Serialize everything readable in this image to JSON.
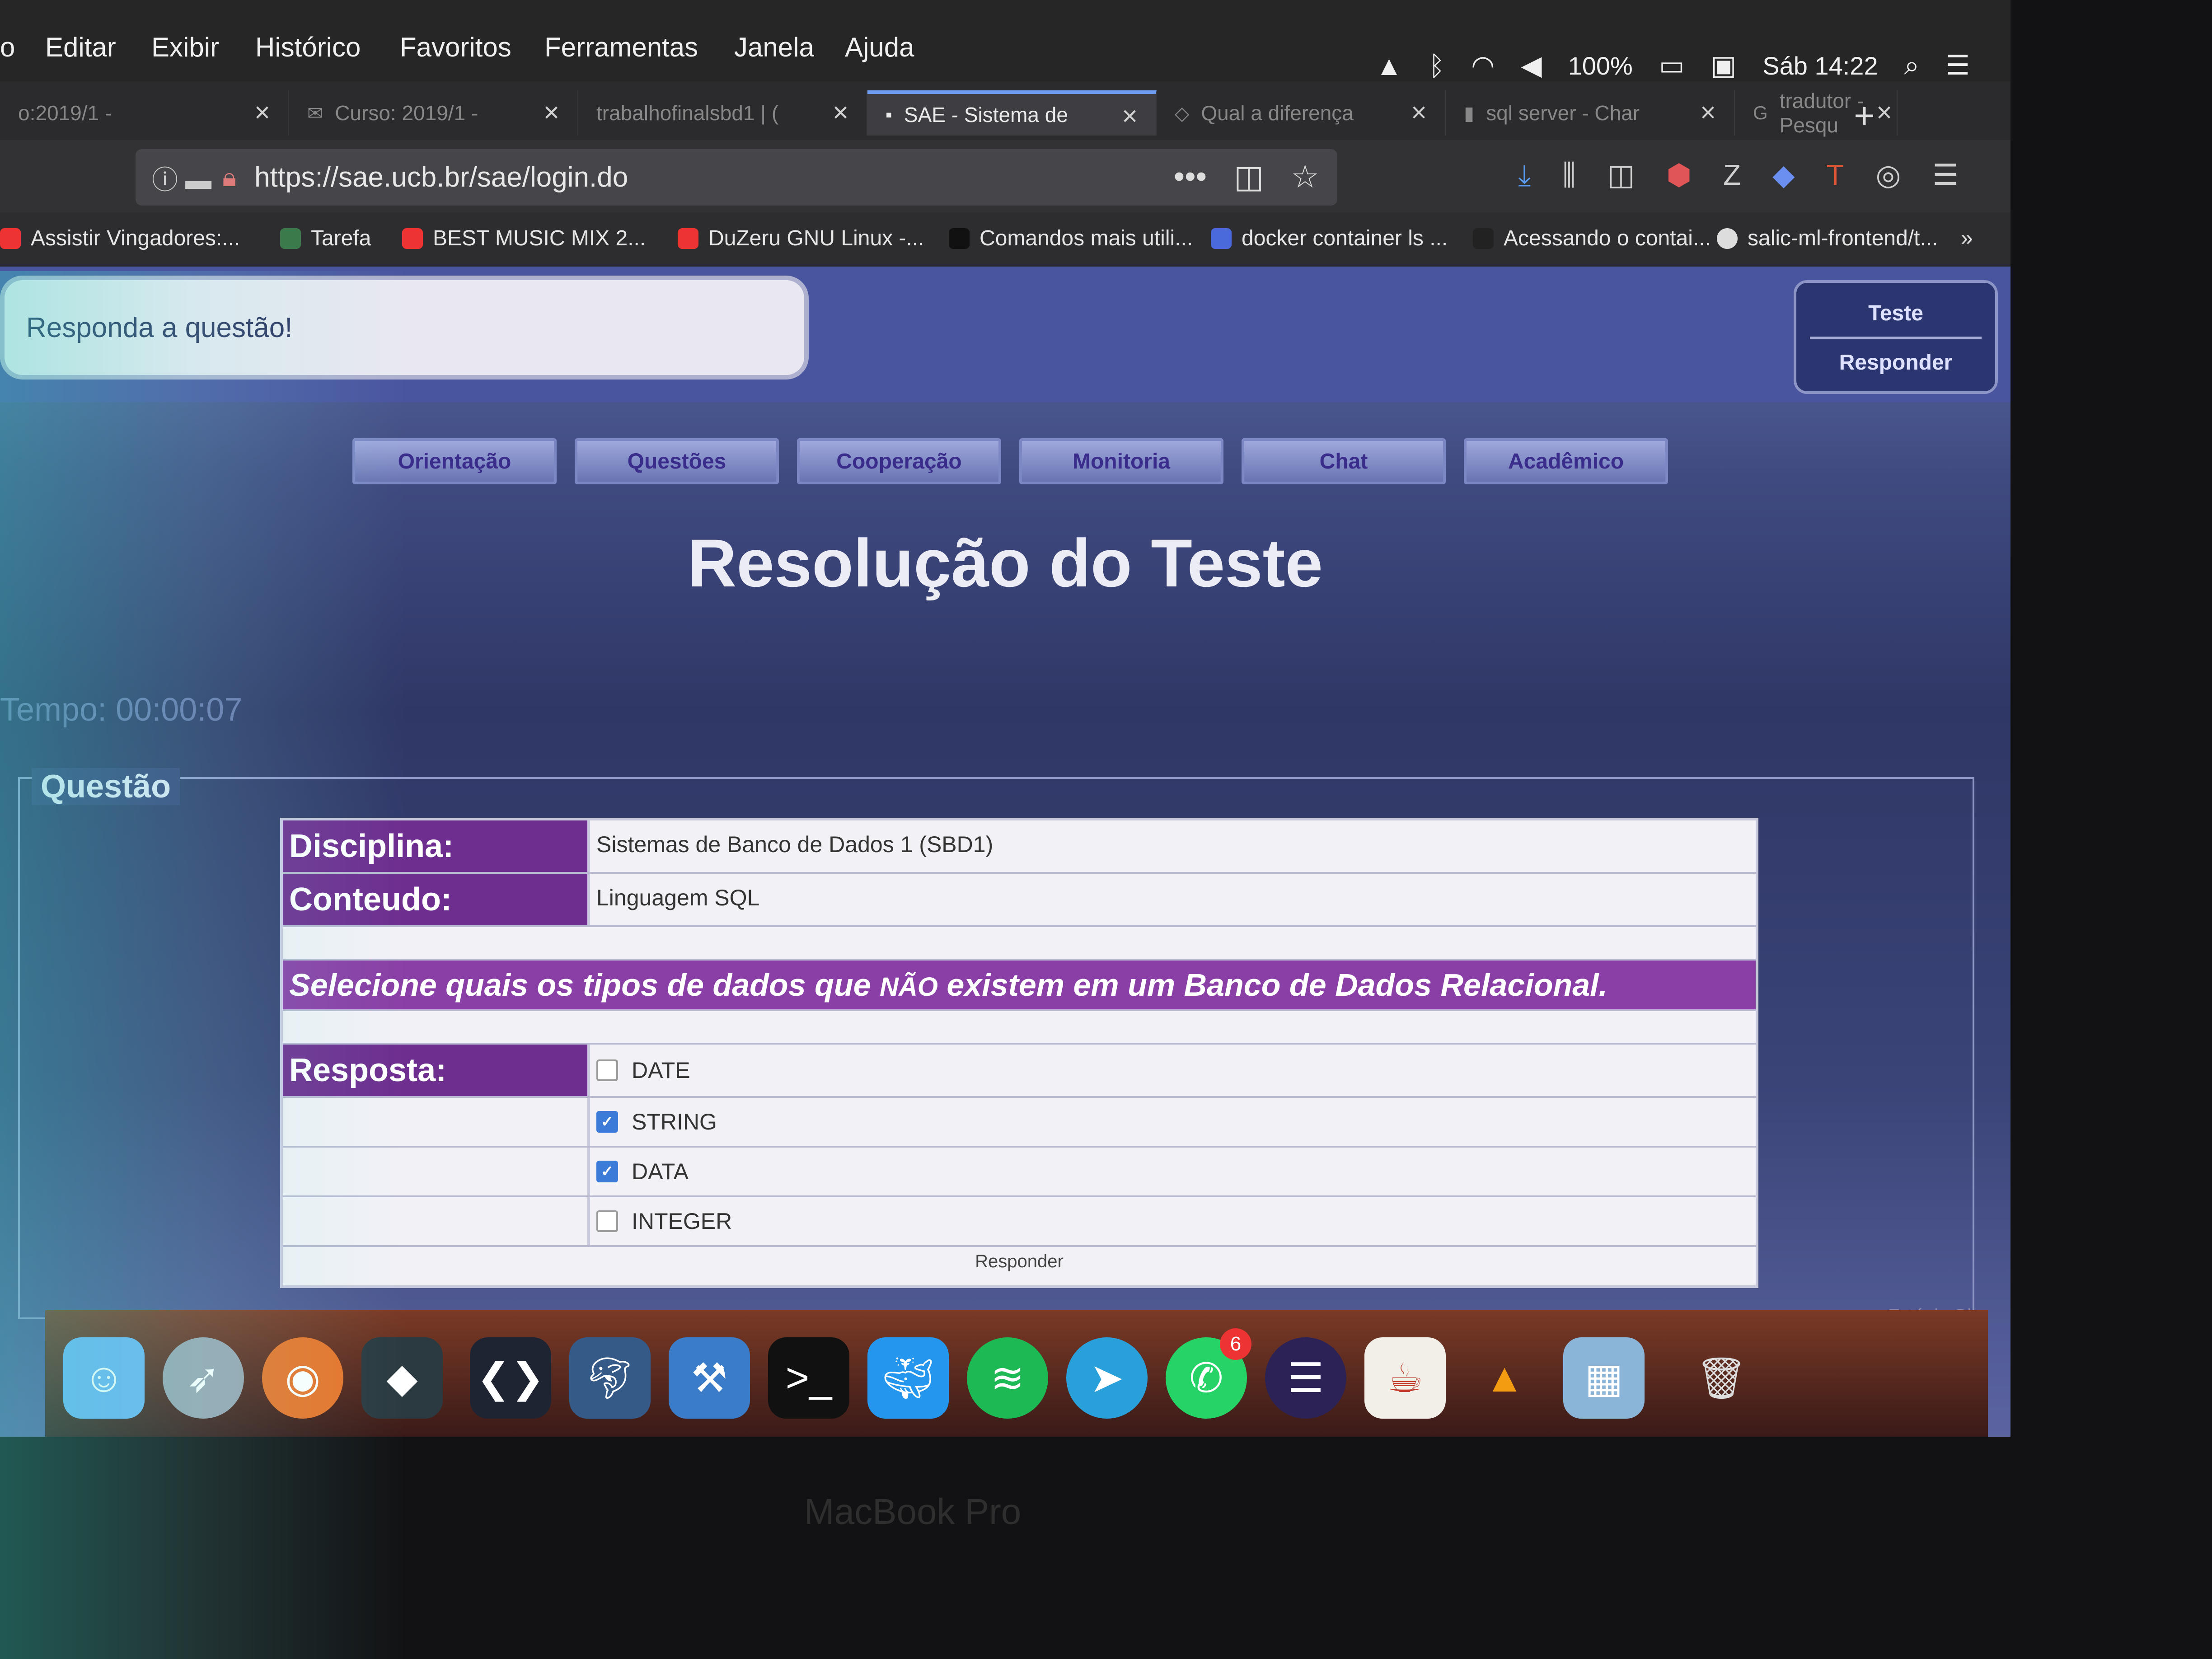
{
  "menubar": {
    "apple_fragment": "o",
    "items": [
      "Editar",
      "Exibir",
      "Histórico",
      "Favoritos",
      "Ferramentas",
      "Janela",
      "Ajuda"
    ],
    "battery": "100%",
    "clock": "Sáb 14:22"
  },
  "tabs": [
    {
      "title": "o:2019/1 -"
    },
    {
      "title": "Curso: 2019/1 -"
    },
    {
      "title": "trabalhofinalsbd1 | ("
    },
    {
      "title": "SAE - Sistema de"
    },
    {
      "title": "Qual a diferença"
    },
    {
      "title": "sql server - Char"
    },
    {
      "title": "tradutor - Pesqu"
    }
  ],
  "urlbar": {
    "url": "https://sae.ucb.br/sae/login.do"
  },
  "bookmarks": [
    "Assistir Vingadores:...",
    "Tarefa",
    "BEST MUSIC MIX 2...",
    "DuZeru GNU Linux -...",
    "Comandos mais utili...",
    "docker container ls ...",
    "Acessando o contai...",
    "salic-ml-frontend/t..."
  ],
  "header": {
    "prompt": "Responda a questão!",
    "teste_title": "Teste",
    "teste_action": "Responder"
  },
  "nav": [
    "Orientação",
    "Questões",
    "Cooperação",
    "Monitoria",
    "Chat",
    "Acadêmico"
  ],
  "page": {
    "title": "Resolução do Teste",
    "tempo": "Tempo: 00:00:07",
    "legend": "Questão",
    "footer_text": "Estágio Obr"
  },
  "question": {
    "disciplina_label": "Disciplina:",
    "disciplina_value": "Sistemas de Banco de Dados 1 (SBD1)",
    "conteudo_label": "Conteudo:",
    "conteudo_value": "Linguagem SQL",
    "text_before": "Selecione quais os tipos de dados que",
    "text_emphasis": "NÃO",
    "text_after": "existem em um Banco de Dados Relacional.",
    "resposta_label": "Resposta:",
    "options": [
      {
        "label": "DATE",
        "checked": false
      },
      {
        "label": "STRING",
        "checked": true
      },
      {
        "label": "DATA",
        "checked": true
      },
      {
        "label": "INTEGER",
        "checked": false
      }
    ],
    "submit_label": "Responder"
  },
  "dock": {
    "whatsapp_badge": "6"
  },
  "bezel": {
    "label": "MacBook Pro"
  }
}
